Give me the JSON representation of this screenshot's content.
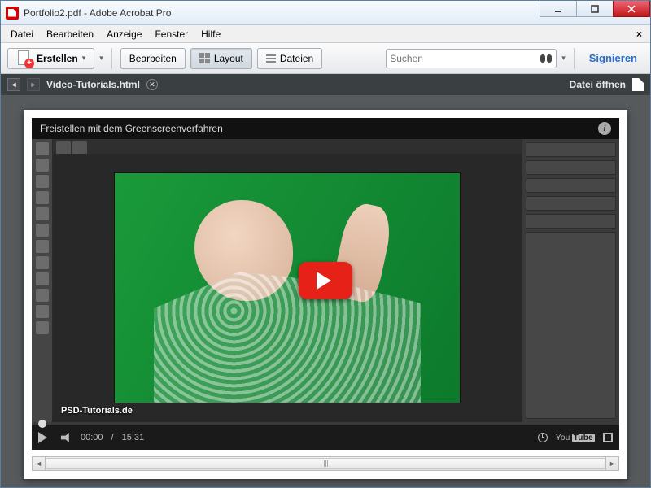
{
  "window": {
    "title": "Portfolio2.pdf - Adobe Acrobat Pro"
  },
  "menu": {
    "datei": "Datei",
    "bearbeiten": "Bearbeiten",
    "anzeige": "Anzeige",
    "fenster": "Fenster",
    "hilfe": "Hilfe"
  },
  "toolbar": {
    "erstellen": "Erstellen",
    "bearbeiten": "Bearbeiten",
    "layout": "Layout",
    "dateien": "Dateien",
    "search_placeholder": "Suchen",
    "signieren": "Signieren"
  },
  "tabstrip": {
    "filename": "Video-Tutorials.html",
    "open_file": "Datei öffnen"
  },
  "video": {
    "title": "Freistellen mit dem Greenscreenverfahren",
    "watermark": "PSD-Tutorials.de",
    "time_current": "00:00",
    "time_total": "15:31",
    "yt_label_a": "You",
    "yt_label_b": "Tube"
  }
}
